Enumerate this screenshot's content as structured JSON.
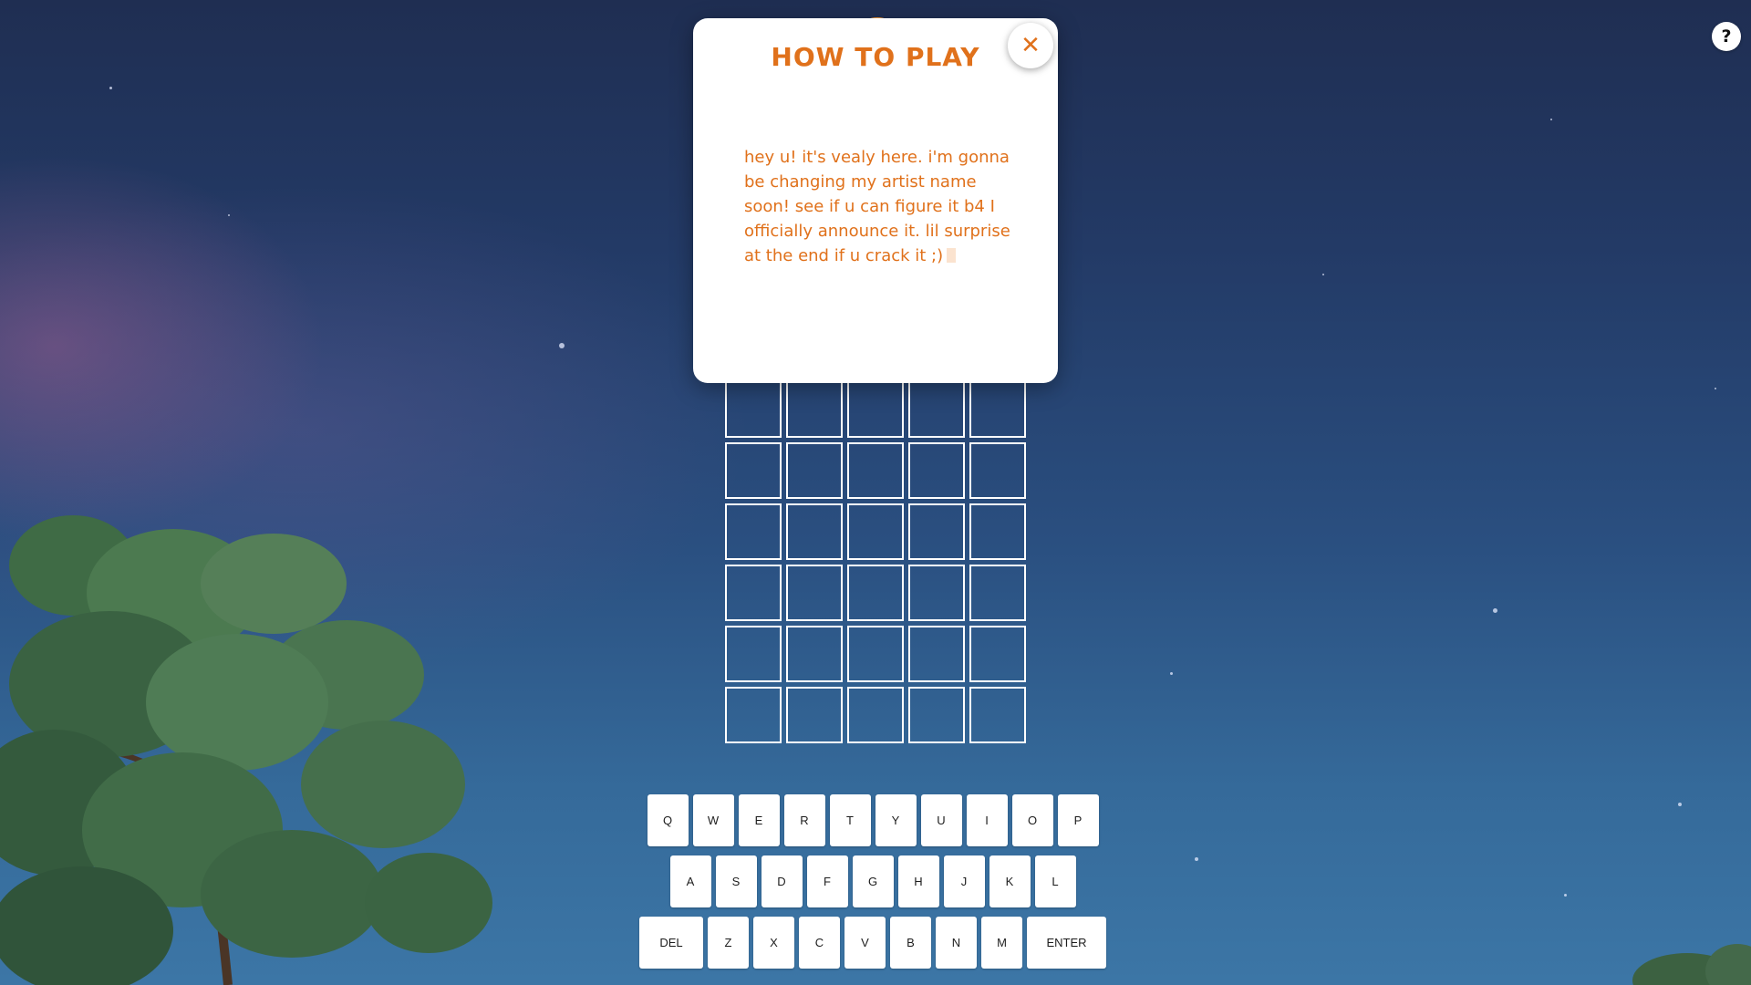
{
  "help_button": {
    "label": "?",
    "icon": "question-mark-icon"
  },
  "modal": {
    "title": "HOW TO PLAY",
    "body": "hey u! it's vealy here. i'm gonna be changing my artist name soon! see if u can figure it b4 I officially announce it. lil surprise at the end if u crack it ;)",
    "close_icon": "close-icon",
    "close_label": "✕"
  },
  "board": {
    "rows": [
      [
        "",
        "",
        "",
        "",
        ""
      ],
      [
        "",
        "",
        "",
        "",
        ""
      ],
      [
        "",
        "",
        "",
        "",
        ""
      ],
      [
        "",
        "",
        "",
        "",
        ""
      ],
      [
        "",
        "",
        "",
        "",
        ""
      ],
      [
        "",
        "",
        "",
        "",
        ""
      ]
    ]
  },
  "keyboard": {
    "rows": [
      [
        "Q",
        "W",
        "E",
        "R",
        "T",
        "Y",
        "U",
        "I",
        "O",
        "P"
      ],
      [
        "A",
        "S",
        "D",
        "F",
        "G",
        "H",
        "J",
        "K",
        "L"
      ],
      [
        "DEL",
        "Z",
        "X",
        "C",
        "V",
        "B",
        "N",
        "M",
        "ENTER"
      ]
    ]
  },
  "colors": {
    "accent": "#e0711b",
    "tile_border": "#ffffff",
    "key_background": "#ffffff"
  }
}
